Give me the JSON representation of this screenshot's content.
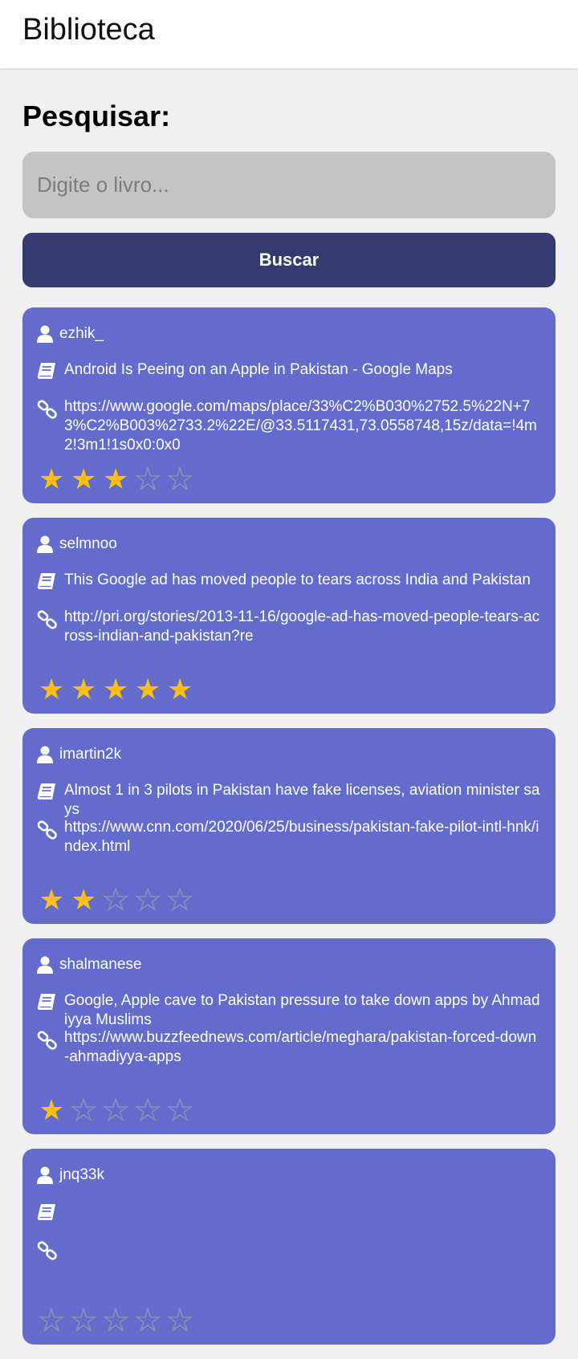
{
  "app": {
    "title": "Biblioteca"
  },
  "search": {
    "heading": "Pesquisar:",
    "placeholder": "Digite o livro...",
    "button_label": "Buscar"
  },
  "colors": {
    "card": "#636ccc",
    "button": "#353a70",
    "star_on": "#ffc107",
    "input": "#c4c4c4"
  },
  "icons": {
    "user": "user-icon",
    "book": "book-icon",
    "link": "link-icon",
    "star": "star-icon"
  },
  "books": [
    {
      "user": "ezhik_",
      "title": "Android Is Peeing on an Apple in Pakistan - Google Maps",
      "url": "https://www.google.com/maps/place/33%C2%B030%2752.5%22N+73%C2%B003%2733.2%22E/@33.5117431,73.0558748,15z/data=!4m2!3m1!1s0x0:0x0",
      "rating": 3
    },
    {
      "user": "selmnoo",
      "title": "This Google ad has moved people to tears across India and Pakistan",
      "url": "http://pri.org/stories/2013-11-16/google-ad-has-moved-people-tears-across-indian-and-pakistan?re",
      "rating": 5
    },
    {
      "user": "imartin2k",
      "title": "Almost 1 in 3 pilots in Pakistan have fake licenses, aviation minister says",
      "url": "https://www.cnn.com/2020/06/25/business/pakistan-fake-pilot-intl-hnk/index.html",
      "rating": 2
    },
    {
      "user": "shalmanese",
      "title": "Google, Apple cave to Pakistan pressure to take down apps by Ahmadiyya Muslims",
      "url": "https://www.buzzfeednews.com/article/meghara/pakistan-forced-down-ahmadiyya-apps",
      "rating": 1
    },
    {
      "user": "jnq33k",
      "title": "",
      "url": "",
      "rating": 0
    }
  ]
}
